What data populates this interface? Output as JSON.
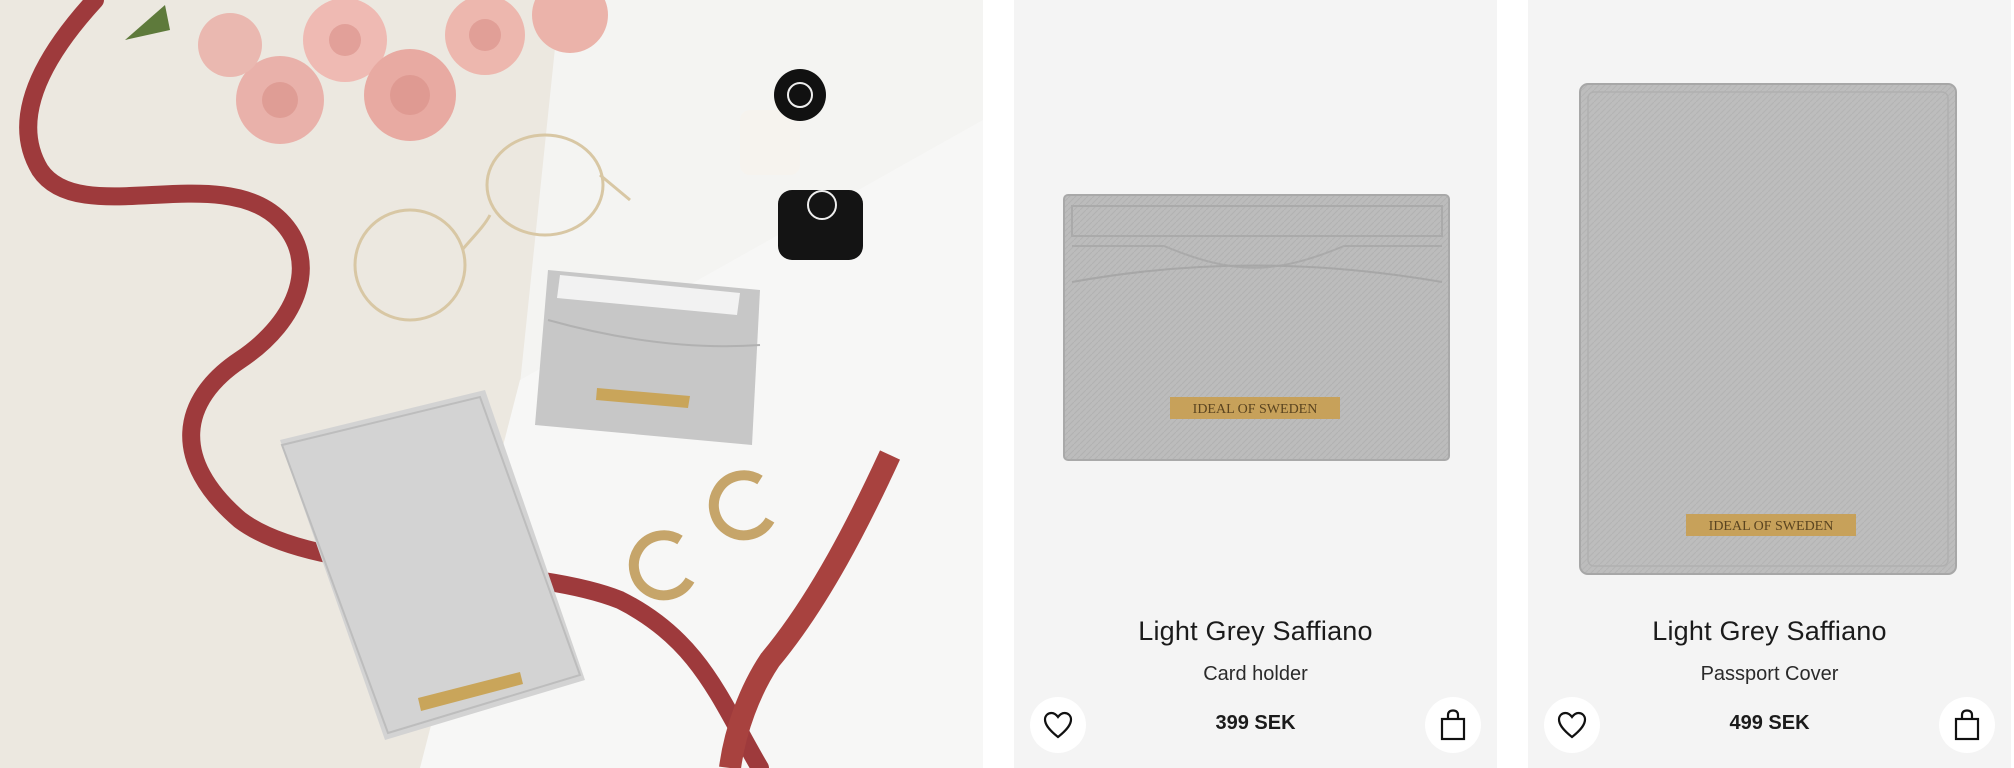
{
  "lifestyle": {
    "alt_label": "",
    "brand_plate": "IDEAL OF SWEDEN"
  },
  "products": [
    {
      "title": "Light Grey Saffiano",
      "subtitle": "Card holder",
      "price": "399 SEK",
      "brand_plate": "IDEAL OF SWEDEN",
      "favorite_icon": "heart-outline-icon",
      "cart_icon": "shopping-bag-icon"
    },
    {
      "title": "Light Grey Saffiano",
      "subtitle": "Passport Cover",
      "price": "499 SEK",
      "brand_plate": "IDEAL OF SWEDEN",
      "favorite_icon": "heart-outline-icon",
      "cart_icon": "shopping-bag-icon"
    }
  ],
  "colors": {
    "card_bg": "#f4f4f4",
    "leather_grey": "#bdbdbd",
    "gold_plate": "#c9a55a",
    "ribbon": "#9e3a3c"
  }
}
